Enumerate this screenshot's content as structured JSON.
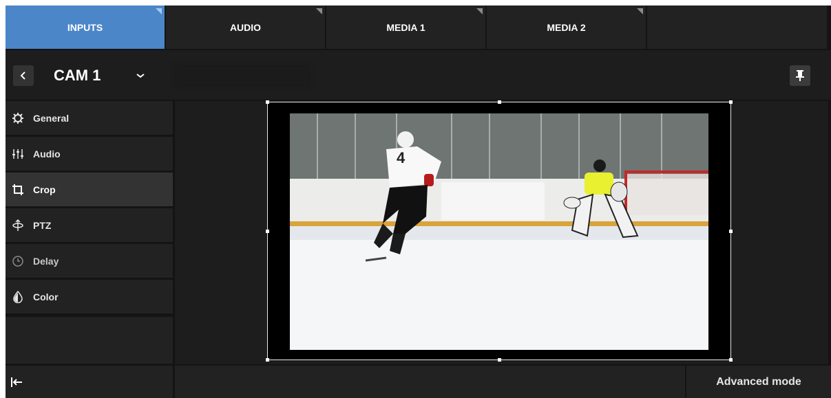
{
  "tabs": [
    {
      "label": "INPUTS",
      "active": true
    },
    {
      "label": "AUDIO",
      "active": false
    },
    {
      "label": "MEDIA 1",
      "active": false
    },
    {
      "label": "MEDIA 2",
      "active": false
    },
    {
      "label": "",
      "active": false
    }
  ],
  "header": {
    "back_icon": "chevron-left-icon",
    "title": "CAM 1",
    "dropdown_icon": "chevron-down-icon",
    "pin_icon": "pin-icon"
  },
  "sidebar": {
    "items": [
      {
        "label": "General",
        "icon": "gear-icon"
      },
      {
        "label": "Audio",
        "icon": "sliders-icon"
      },
      {
        "label": "Crop",
        "icon": "crop-icon",
        "active": true
      },
      {
        "label": "PTZ",
        "icon": "ptz-icon"
      },
      {
        "label": "Delay",
        "icon": "clock-icon"
      },
      {
        "label": "Color",
        "icon": "drop-icon"
      }
    ]
  },
  "preview": {
    "description_icon": "camera-preview-image"
  },
  "footer": {
    "collapse_icon": "collapse-left-icon",
    "advanced_label": "Advanced mode"
  },
  "colors": {
    "accent": "#4a86c8",
    "background": "#141414",
    "panel": "#222222"
  }
}
